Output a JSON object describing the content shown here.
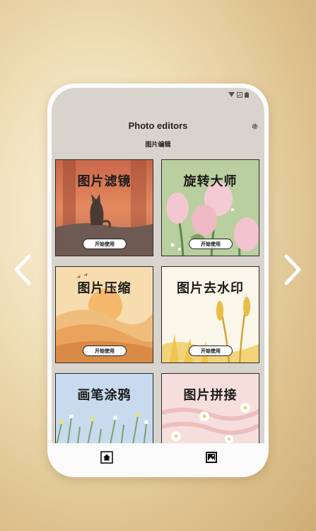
{
  "app": {
    "title": "Photo editors",
    "subtitle": "图片编辑"
  },
  "nav": {
    "prev_icon": "chevron-left-icon",
    "next_icon": "chevron-right-icon"
  },
  "status_bar": {
    "icons": [
      "wifi-icon",
      "signal-icon",
      "battery-icon"
    ]
  },
  "settings_icon": "gear-icon",
  "cards": [
    {
      "title": "图片滤镜",
      "button": "开始使用"
    },
    {
      "title": "旋转大师",
      "button": "开始使用"
    },
    {
      "title": "图片压缩",
      "button": "开始使用"
    },
    {
      "title": "图片去水印",
      "button": "开始使用"
    },
    {
      "title": "画笔涂鸦"
    },
    {
      "title": "图片拼接"
    }
  ],
  "bottom_tabs": [
    {
      "icon": "home-icon",
      "selected": true
    },
    {
      "icon": "image-icon",
      "selected": false
    }
  ],
  "colors": {
    "screen_bg": "#d8d4cd",
    "button_border": "#222222"
  }
}
